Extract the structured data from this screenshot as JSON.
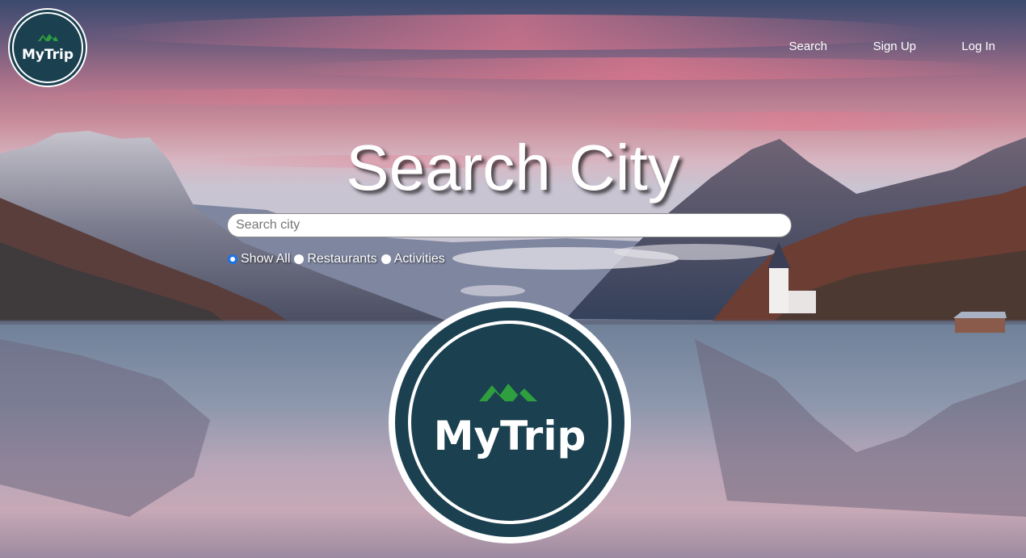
{
  "brand": {
    "name": "MyTrip"
  },
  "nav": {
    "links": [
      {
        "label": "Search"
      },
      {
        "label": "Sign Up"
      },
      {
        "label": "Log In"
      }
    ]
  },
  "hero": {
    "title": "Search City"
  },
  "search": {
    "placeholder": "Search city",
    "value": ""
  },
  "filters": {
    "options": [
      {
        "label": "Show All",
        "checked": true
      },
      {
        "label": "Restaurants",
        "checked": false
      },
      {
        "label": "Activities",
        "checked": false
      }
    ]
  },
  "colors": {
    "logo_bg": "#1b4050",
    "logo_ring": "#ffffff",
    "mountain_green": "#2e9e3f",
    "accent_blue": "#1a73e8"
  },
  "icons": {
    "logo_mountain": "mountain-icon"
  }
}
